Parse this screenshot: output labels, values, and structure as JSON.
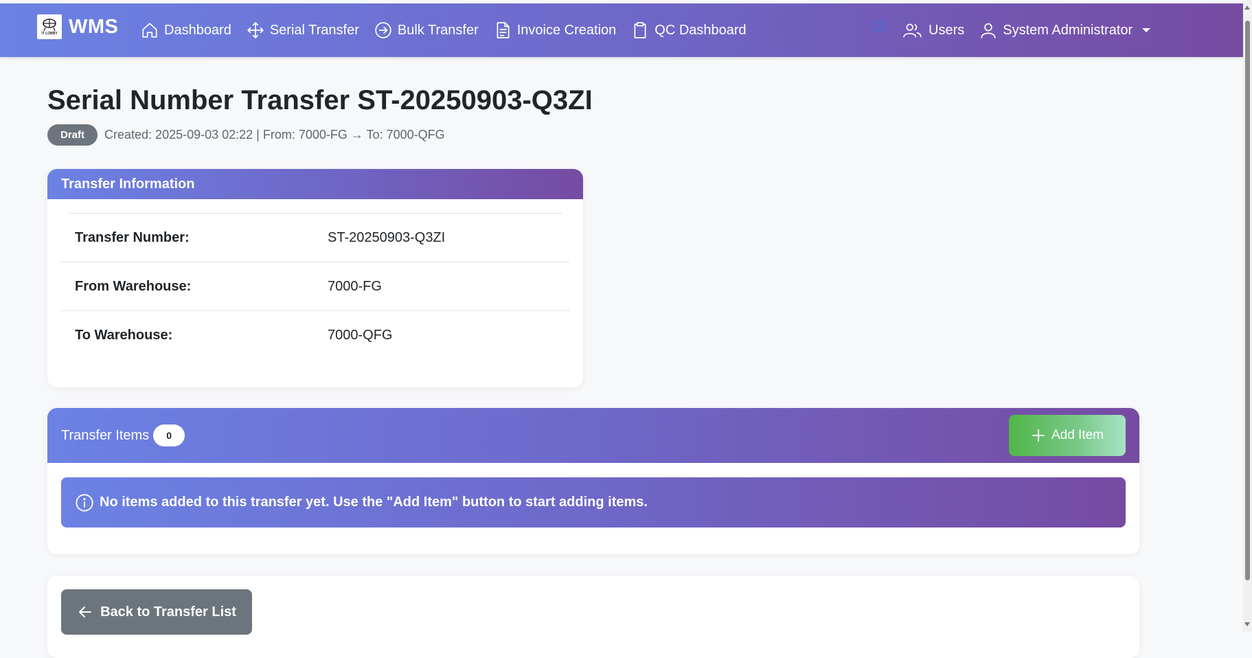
{
  "navbar": {
    "logo_text": "IT LOBBY",
    "brand": "WMS",
    "links": [
      {
        "label": "Dashboard",
        "icon": "house-icon"
      },
      {
        "label": "Serial Transfer",
        "icon": "arrows-move-icon"
      },
      {
        "label": "Bulk Transfer",
        "icon": "arrow-right-circle-icon"
      },
      {
        "label": "Invoice Creation",
        "icon": "file-text-icon"
      },
      {
        "label": "QC Dashboard",
        "icon": "clipboard-icon"
      }
    ],
    "users_label": "Users",
    "user_label": "System Administrator"
  },
  "page": {
    "title": "Serial Number Transfer ST-20250903-Q3ZI",
    "status_badge": "Draft",
    "meta": "Created: 2025-09-03 02:22 | From: 7000-FG → To: 7000-QFG"
  },
  "info_card": {
    "header": "Transfer Information",
    "rows": [
      {
        "label": "Transfer Number:",
        "value": "ST-20250903-Q3ZI"
      },
      {
        "label": "From Warehouse:",
        "value": "7000-FG"
      },
      {
        "label": "To Warehouse:",
        "value": "7000-QFG"
      }
    ]
  },
  "items_card": {
    "header": "Transfer Items",
    "count": "0",
    "add_button": "Add Item",
    "empty_message": "No items added to this transfer yet. Use the \"Add Item\" button to start adding items."
  },
  "back_button": "Back to Transfer List",
  "colors": {
    "gradient_start": "#6c82e4",
    "gradient_end": "#764ba2",
    "badge_gray": "#6c757d",
    "add_green": "#52b649"
  }
}
